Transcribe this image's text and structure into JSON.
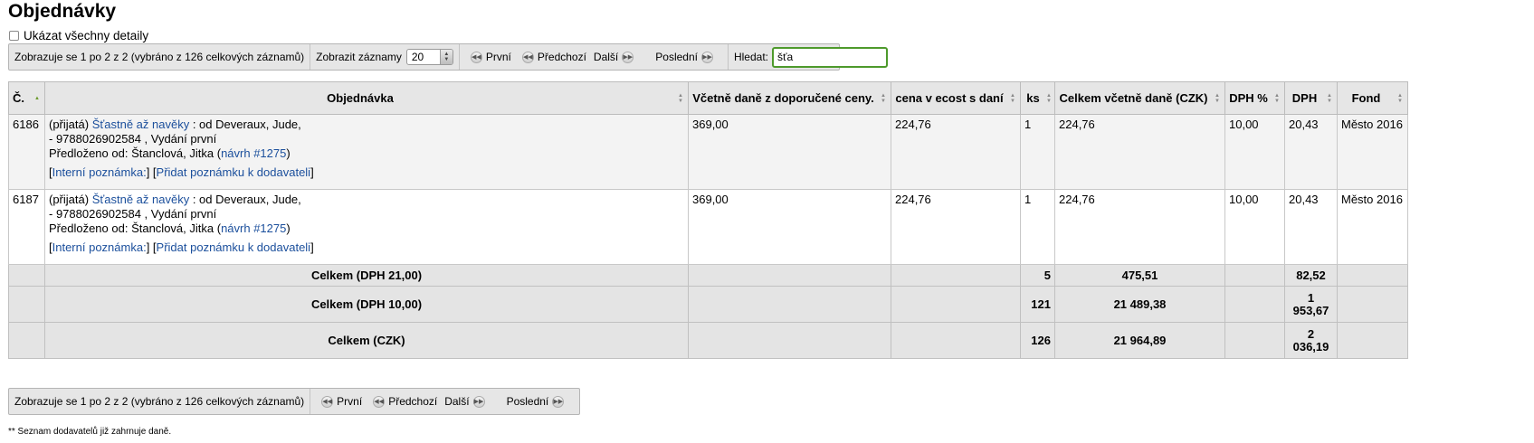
{
  "page": {
    "title": "Objednávky",
    "show_all_label": "Ukázat všechny detaily",
    "footnote": "** Seznam dodavatelů již zahrnuje daně."
  },
  "pager_top": {
    "info": "Zobrazuje se 1 po 2 z 2 (vybráno z 126 celkových záznamů)",
    "show_label": "Zobrazit záznamy",
    "page_size": "20",
    "first": "První",
    "prev": "Předchozí",
    "next": "Další",
    "last": "Poslední",
    "search_label": "Hledat:",
    "search_value": "šťa"
  },
  "pager_bottom": {
    "info": "Zobrazuje se 1 po 2 z 2 (vybráno z 126 celkových záznamů)",
    "first": "První",
    "prev": "Předchozí",
    "next": "Další",
    "last": "Poslední"
  },
  "table": {
    "headers": {
      "num": "Č.",
      "order": "Objednávka",
      "price_rrp": "Včetně daně z doporučené ceny.",
      "price_ecost": "cena v ecost s daní",
      "qty": "ks",
      "total": "Celkem včetně daně (CZK)",
      "vat_pct": "DPH %",
      "vat": "DPH",
      "fund": "Fond"
    },
    "rows": [
      {
        "num": "6186",
        "status": "(přijatá)",
        "title_link": "Šťastně až navěky",
        "author": " : od Deveraux, Jude,",
        "isbn_line": "- 9788026902584 , Vydání první",
        "submitted_label": "Předloženo od: Štanclová, Jitka (",
        "suggestion_link": "návrh #1275",
        "submitted_end": ")",
        "internal_note": "Interní poznámka:",
        "vendor_note": "Přidat poznámku k dodavateli",
        "price_rrp": "369,00",
        "price_ecost": "224,76",
        "qty": "1",
        "total": "224,76",
        "vat_pct": "10,00",
        "vat": "20,43",
        "fund": "Město 2016"
      },
      {
        "num": "6187",
        "status": "(přijatá)",
        "title_link": "Šťastně až navěky",
        "author": " : od Deveraux, Jude,",
        "isbn_line": "- 9788026902584 , Vydání první",
        "submitted_label": "Předloženo od: Štanclová, Jitka (",
        "suggestion_link": "návrh #1275",
        "submitted_end": ")",
        "internal_note": "Interní poznámka:",
        "vendor_note": "Přidat poznámku k dodavateli",
        "price_rrp": "369,00",
        "price_ecost": "224,76",
        "qty": "1",
        "total": "224,76",
        "vat_pct": "10,00",
        "vat": "20,43",
        "fund": "Město 2016"
      }
    ],
    "totals": [
      {
        "label": "Celkem (DPH 21,00)",
        "qty": "5",
        "total": "475,51",
        "vat_line1": "82,52",
        "vat_line2": ""
      },
      {
        "label": "Celkem (DPH 10,00)",
        "qty": "121",
        "total": "21 489,38",
        "vat_line1": "1",
        "vat_line2": "953,67"
      },
      {
        "label": "Celkem (CZK)",
        "qty": "126",
        "total": "21 964,89",
        "vat_line1": "2",
        "vat_line2": "036,19"
      }
    ]
  }
}
